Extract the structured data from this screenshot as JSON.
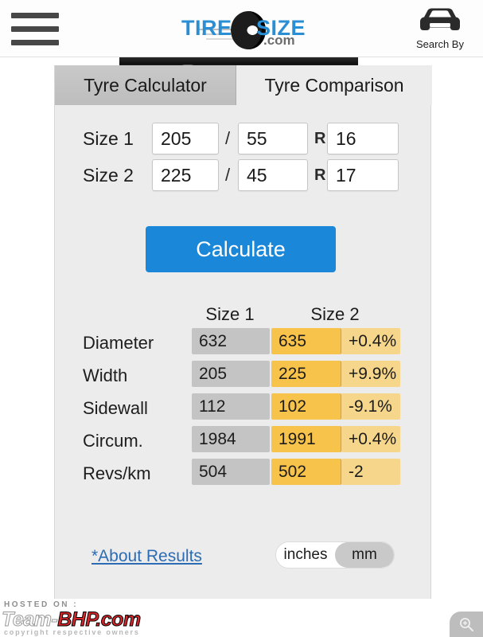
{
  "header": {
    "menu_icon": "hamburger-menu-icon",
    "logo": {
      "part1": "TIRE",
      "part2": "SIZE",
      "suffix": ".com",
      "color": "#2a8ed4"
    },
    "search_by": {
      "icon": "car-front-icon",
      "label": "Search By"
    }
  },
  "tabs": [
    {
      "label": "Tyre Calculator",
      "active": false
    },
    {
      "label": "Tyre Comparison",
      "active": true
    }
  ],
  "inputs": {
    "row1": {
      "label": "Size 1",
      "width": "205",
      "separator": "/",
      "aspect": "55",
      "radial": "R",
      "diameter": "16"
    },
    "row2": {
      "label": "Size 2",
      "width": "225",
      "separator": "/",
      "aspect": "45",
      "radial": "R",
      "diameter": "17"
    }
  },
  "calculate_button": {
    "label": "Calculate",
    "color": "#1b87d8"
  },
  "results": {
    "columns": [
      "Size 1",
      "Size 2"
    ],
    "rows": [
      {
        "label": "Diameter",
        "size1": "632",
        "size2": "635",
        "diff": "+0.4%"
      },
      {
        "label": "Width",
        "size1": "205",
        "size2": "225",
        "diff": "+9.9%"
      },
      {
        "label": "Sidewall",
        "size1": "112",
        "size2": "102",
        "diff": "-9.1%"
      },
      {
        "label": "Circum.",
        "size1": "1984",
        "size2": "1991",
        "diff": "+0.4%"
      },
      {
        "label": "Revs/km",
        "size1": "504",
        "size2": "502",
        "diff": "-2"
      }
    ],
    "colors": {
      "size1_cell": "#c4c4c4",
      "size2_cell": "#f8c34a",
      "diff_cell": "#f6d68a"
    }
  },
  "footer": {
    "about_link": "*About Results",
    "units": {
      "options": [
        "inches",
        "mm"
      ],
      "selected": "mm"
    }
  },
  "watermark": {
    "hosted": "HOSTED ON :",
    "team": "Team-",
    "bhp": "BHP.com",
    "copyright": "copyright respective owners"
  },
  "zoom_button": {
    "icon": "magnifier-plus-icon"
  }
}
